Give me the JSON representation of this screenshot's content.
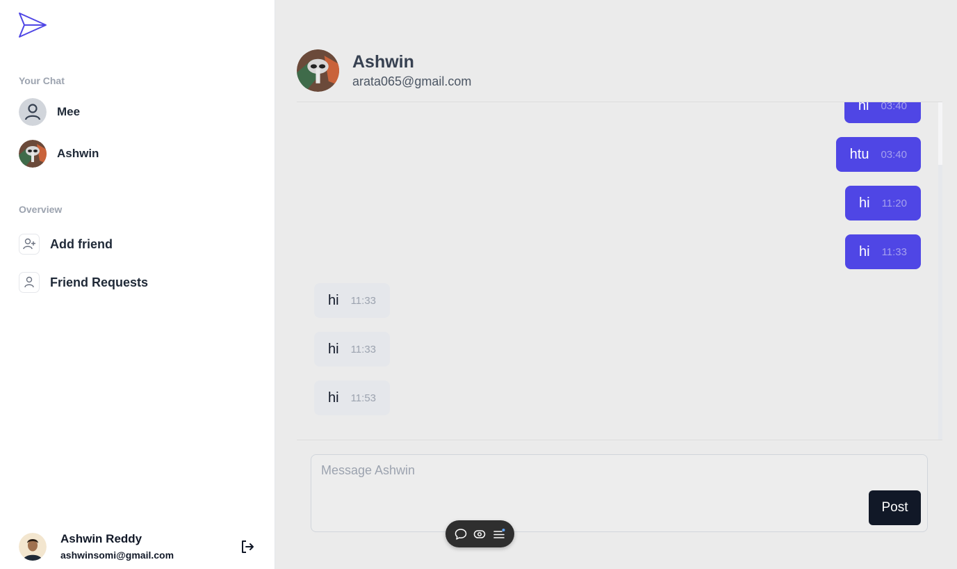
{
  "sidebar": {
    "your_chat_label": "Your Chat",
    "chats": [
      {
        "name": "Mee",
        "avatar": "default-user-avatar"
      },
      {
        "name": "Ashwin",
        "avatar": "photo-avatar"
      }
    ],
    "overview_label": "Overview",
    "nav": [
      {
        "label": "Add friend",
        "icon": "user-plus-icon"
      },
      {
        "label": "Friend Requests",
        "icon": "user-icon"
      }
    ],
    "current_user": {
      "name": "Ashwin Reddy",
      "email": "ashwinsomi@gmail.com"
    },
    "logout_icon": "logout-icon"
  },
  "chat": {
    "partner_name": "Ashwin",
    "partner_email": "arata065@gmail.com",
    "messages": [
      {
        "text": "hi",
        "time": "03:40",
        "direction": "out"
      },
      {
        "text": "htu",
        "time": "03:40",
        "direction": "out"
      },
      {
        "text": "hi",
        "time": "11:20",
        "direction": "out"
      },
      {
        "text": "hi",
        "time": "11:33",
        "direction": "out"
      },
      {
        "text": "hi",
        "time": "11:33",
        "direction": "in"
      },
      {
        "text": "hi",
        "time": "11:33",
        "direction": "in"
      },
      {
        "text": "hi",
        "time": "11:53",
        "direction": "in"
      }
    ]
  },
  "composer": {
    "placeholder": "Message Ashwin",
    "value": "",
    "post_label": "Post"
  },
  "toolbar": {
    "icons": [
      "comment-icon",
      "eye-icon",
      "menu-icon"
    ]
  },
  "colors": {
    "accent": "#4f46e5",
    "sidebar_bg": "#ffffff",
    "main_bg": "#ebebeb",
    "incoming_bubble": "#e5e7eb",
    "post_button": "#111827"
  }
}
